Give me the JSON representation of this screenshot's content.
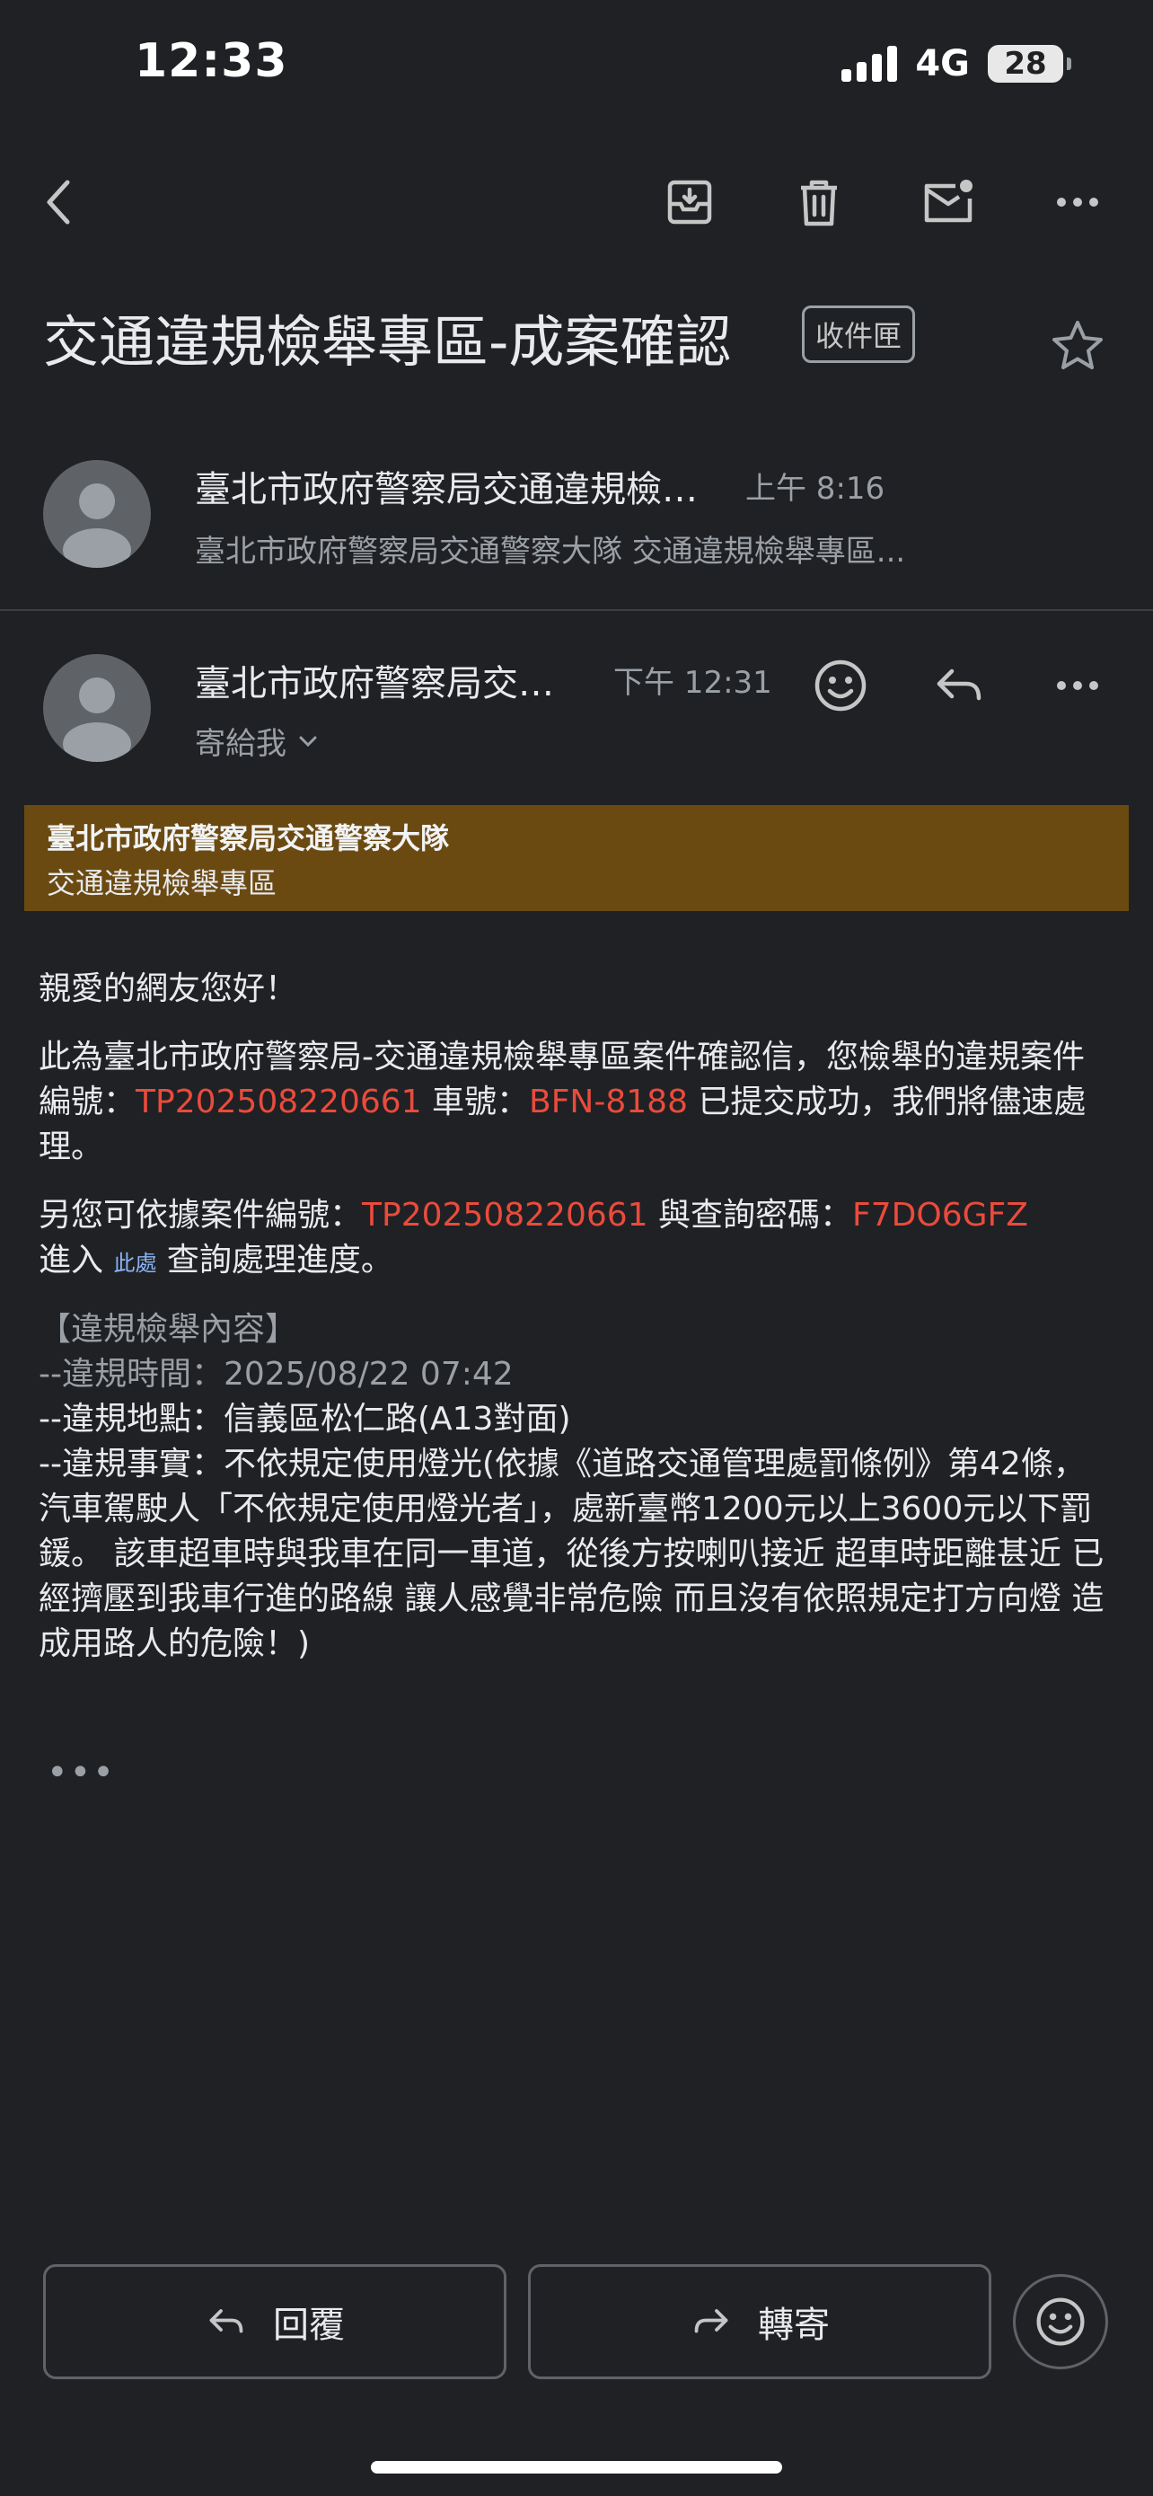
{
  "status_bar": {
    "time": "12:33",
    "network": "4G",
    "battery": "28"
  },
  "toolbar": {
    "icons": [
      "back-icon",
      "archive-icon",
      "delete-icon",
      "mark-unread-icon",
      "more-icon"
    ]
  },
  "subject": {
    "title": "交通違規檢舉專區-成案確認",
    "label": "收件匣"
  },
  "thread": [
    {
      "sender": "臺北市政府警察局交通違規檢…",
      "time": "上午 8:16",
      "snippet": "臺北市政府警察局交通警察大隊 交通違規檢舉專區..."
    },
    {
      "sender": "臺北市政府警察局交…",
      "time": "下午 12:31",
      "to": "寄給我"
    }
  ],
  "banner": {
    "title": "臺北市政府警察局交通警察大隊",
    "subtitle": "交通違規檢舉專區"
  },
  "message": {
    "greeting": "親愛的網友您好！",
    "p1_a": "此為臺北市政府警察局-交通違規檢舉專區案件確認信，您檢舉的違規案件編號：",
    "case_no": "TP202508220661",
    "p1_b": " 車號：",
    "plate": "BFN-8188",
    "p1_c": " 已提交成功，我們將儘速處理。",
    "p2_a": "另您可依據案件編號：",
    "p2_b": " 與查詢密碼：",
    "password": "F7DO6GFZ",
    "p2_c": "進入 ",
    "link_text": "此處",
    "p2_d": " 查詢處理進度。",
    "section_title": "【違規檢舉內容】",
    "time_line": "--違規時間：2025/08/22 07:42",
    "place_line": "--違規地點：信義區松仁路(A13對面)",
    "fact_line": "--違規事實：不依規定使用燈光(依據《道路交通管理處罰條例》第42條，汽車駕駛人「不依規定使用燈光者」，處新臺幣1200元以上3600元以下罰鍰。 該車超車時與我車在同一車道，從後方按喇叭接近 超車時距離甚近 已經擠壓到我車行進的路線 讓人感覺非常危險 而且沒有依照規定打方向燈 造成用路人的危險！)",
    "ellipsis": "•••"
  },
  "actions": {
    "reply": "回覆",
    "forward": "轉寄"
  }
}
